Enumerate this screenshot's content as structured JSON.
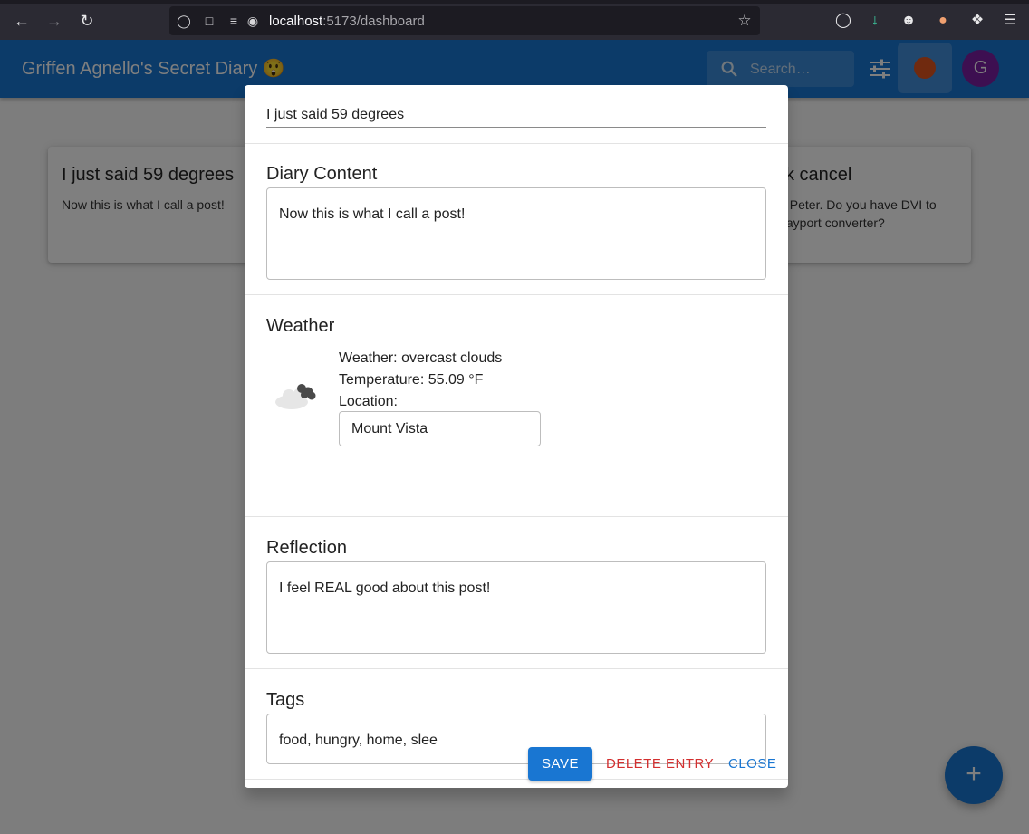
{
  "browser": {
    "url_host": "localhost",
    "url_path": ":5173/dashboard"
  },
  "app": {
    "title": "Griffen Agnello's Secret Diary 😲",
    "search_placeholder": "Search…",
    "avatar_letter": "G",
    "fab_label": "+"
  },
  "cards": [
    {
      "title": "I just said 59 degrees",
      "body": "Now this is what I call a post!"
    },
    {
      "title": "ck cancel",
      "body": "lo Peter. Do you have DVI to playport converter?"
    }
  ],
  "dialog": {
    "title_value": "I just said 59 degrees",
    "content_label": "Diary Content",
    "content_value": "Now this is what I call a post!",
    "weather_label": "Weather",
    "weather_text": "Weather: overcast clouds",
    "temperature_text": "Temperature: 55.09 °F",
    "location_label": "Location:",
    "location_value": "Mount Vista",
    "reflection_label": "Reflection",
    "reflection_value": "I feel REAL good about this post!",
    "tags_label": "Tags",
    "tags_value": "food, hungry, home, slee",
    "save_label": "SAVE",
    "delete_label": "DELETE ENTRY",
    "close_label": "CLOSE"
  },
  "colors": {
    "primary": "#1976d2",
    "danger": "#d32f2f",
    "avatar": "#7b1fa2"
  }
}
